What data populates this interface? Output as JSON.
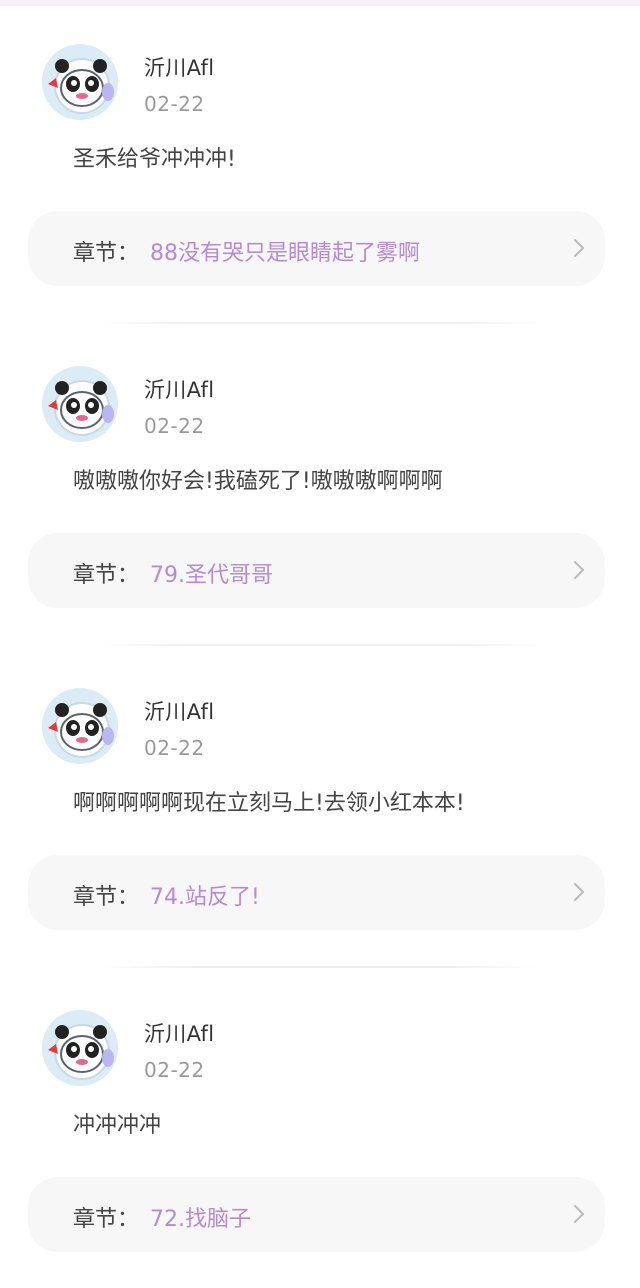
{
  "icons": {
    "avatar": "panda-avatar-icon",
    "chevron": "chevron-right-icon"
  },
  "colors": {
    "chapter_title": "#b58ad8",
    "chapter_bg": "#f7f7f7",
    "date": "#9a9a9a"
  },
  "comments": [
    {
      "username": "沂川Afl",
      "date": "02-22",
      "text": "圣禾给爷冲冲冲!",
      "chapter_label": "章节：",
      "chapter_title": "88没有哭只是眼睛起了雾啊"
    },
    {
      "username": "沂川Afl",
      "date": "02-22",
      "text": "嗷嗷嗷你好会!我磕死了!嗷嗷嗷啊啊啊",
      "chapter_label": "章节：",
      "chapter_title": "79.圣代哥哥"
    },
    {
      "username": "沂川Afl",
      "date": "02-22",
      "text": "啊啊啊啊啊现在立刻马上!去领小红本本!",
      "chapter_label": "章节：",
      "chapter_title": "74.站反了!"
    },
    {
      "username": "沂川Afl",
      "date": "02-22",
      "text": "冲冲冲冲",
      "chapter_label": "章节：",
      "chapter_title": "72.找脑子"
    }
  ]
}
